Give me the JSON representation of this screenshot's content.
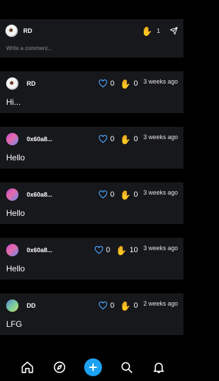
{
  "composer": {
    "author": "RD",
    "wave_count": "1",
    "placeholder": "Write a comment..."
  },
  "posts": [
    {
      "author": "RD",
      "likes": "0",
      "claps": "0",
      "time": "3 weeks ago",
      "text": "Hi..."
    },
    {
      "author": "0x60a8...",
      "likes": "0",
      "claps": "0",
      "time": "3 weeks ago",
      "text": "Hello"
    },
    {
      "author": "0x60a8...",
      "likes": "0",
      "claps": "0",
      "time": "3 weeks ago",
      "text": "Hello"
    },
    {
      "author": "0x60a8...",
      "likes": "0",
      "claps": "10",
      "time": "3 weeks ago",
      "text": "Hello"
    },
    {
      "author": "DD",
      "likes": "0",
      "claps": "0",
      "time": "2 weeks ago",
      "text": "LFG"
    }
  ],
  "nav": {
    "items": [
      "home-icon",
      "compass-icon",
      "plus-icon",
      "search-icon",
      "bell-icon"
    ],
    "accent": "#1da1f2"
  }
}
